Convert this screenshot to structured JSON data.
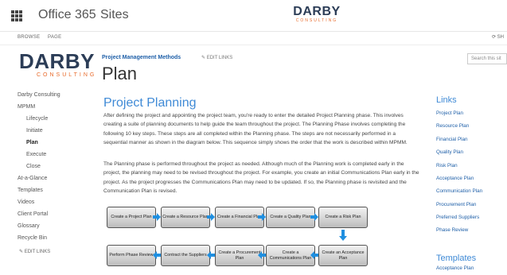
{
  "suitebar": {
    "app_title": "Office 365",
    "sites_label": "Sites",
    "logo_big": "DARBY",
    "logo_small": "CONSULTING"
  },
  "ribbon": {
    "browse": "BROWSE",
    "page": "PAGE",
    "share": "SH"
  },
  "header": {
    "logo_big": "DARBY",
    "logo_small": "CONSULTING",
    "breadcrumb": "Project Management Methods",
    "edit_links": "EDIT LINKS",
    "page_title": "Plan",
    "search_placeholder": "Search this sit"
  },
  "leftnav": {
    "items": [
      {
        "label": "Darby Consulting"
      },
      {
        "label": "MPMM"
      },
      {
        "label": "Lifecycle"
      },
      {
        "label": "Initiate"
      },
      {
        "label": "Plan"
      },
      {
        "label": "Execute"
      },
      {
        "label": "Close"
      },
      {
        "label": "At-a-Glance"
      },
      {
        "label": "Templates"
      },
      {
        "label": "Videos"
      },
      {
        "label": "Client Portal"
      },
      {
        "label": "Glossary"
      },
      {
        "label": "Recycle Bin"
      }
    ],
    "edit_links": "EDIT LINKS"
  },
  "main": {
    "heading": "Project Planning",
    "paragraph1": "After defining the project and appointing the project team, you're ready to enter the detailed Project Planning phase. This involves creating a suite of planning documents to help guide the team throughout the project. The Planning Phase involves completing the following 10 key steps. These steps are all completed within the Planning phase. The steps are not necessarily performed in a sequential manner as shown in the diagram below. This sequence simply shows the order that the work is described within MPMM.",
    "paragraph2": "The Planning phase is performed throughout the project as needed. Although much of the Planning work is completed early in the project, the planning may need to be revised throughout the project. For example, you create an initial Communications Plan early in the project. As the project progresses the Communications Plan may need to be updated. If so, the Planning phase is revisited and the Communication Plan is revised.",
    "diagram": {
      "row1": [
        "Create a Project Plan",
        "Create a Resource Plan",
        "Create a Financial Plan",
        "Create a Quality Plan",
        "Create a Risk Plan"
      ],
      "row2": [
        "Perform Phase Review",
        "Contract the Suppliers",
        "Create a Procurement Plan",
        "Create a Communications Plan",
        "Create an Acceptance Plan"
      ],
      "arrow_color": "#1f8fe0"
    }
  },
  "right": {
    "links_heading": "Links",
    "links": [
      "Project Plan",
      "Resource Plan",
      "Financial Plan",
      "Quality Plan",
      "Risk Plan",
      "Acceptance Plan",
      "Communication Plan",
      "Procurement Plan",
      "Preferred Suppliers",
      "Phase Review"
    ],
    "templates_heading": "Templates",
    "templates_first": "Acceptance Plan"
  },
  "colors": {
    "accent": "#3f8ad6",
    "link": "#1e5fa8",
    "brand_navy": "#2c3d57",
    "brand_orange": "#e86a2a"
  }
}
